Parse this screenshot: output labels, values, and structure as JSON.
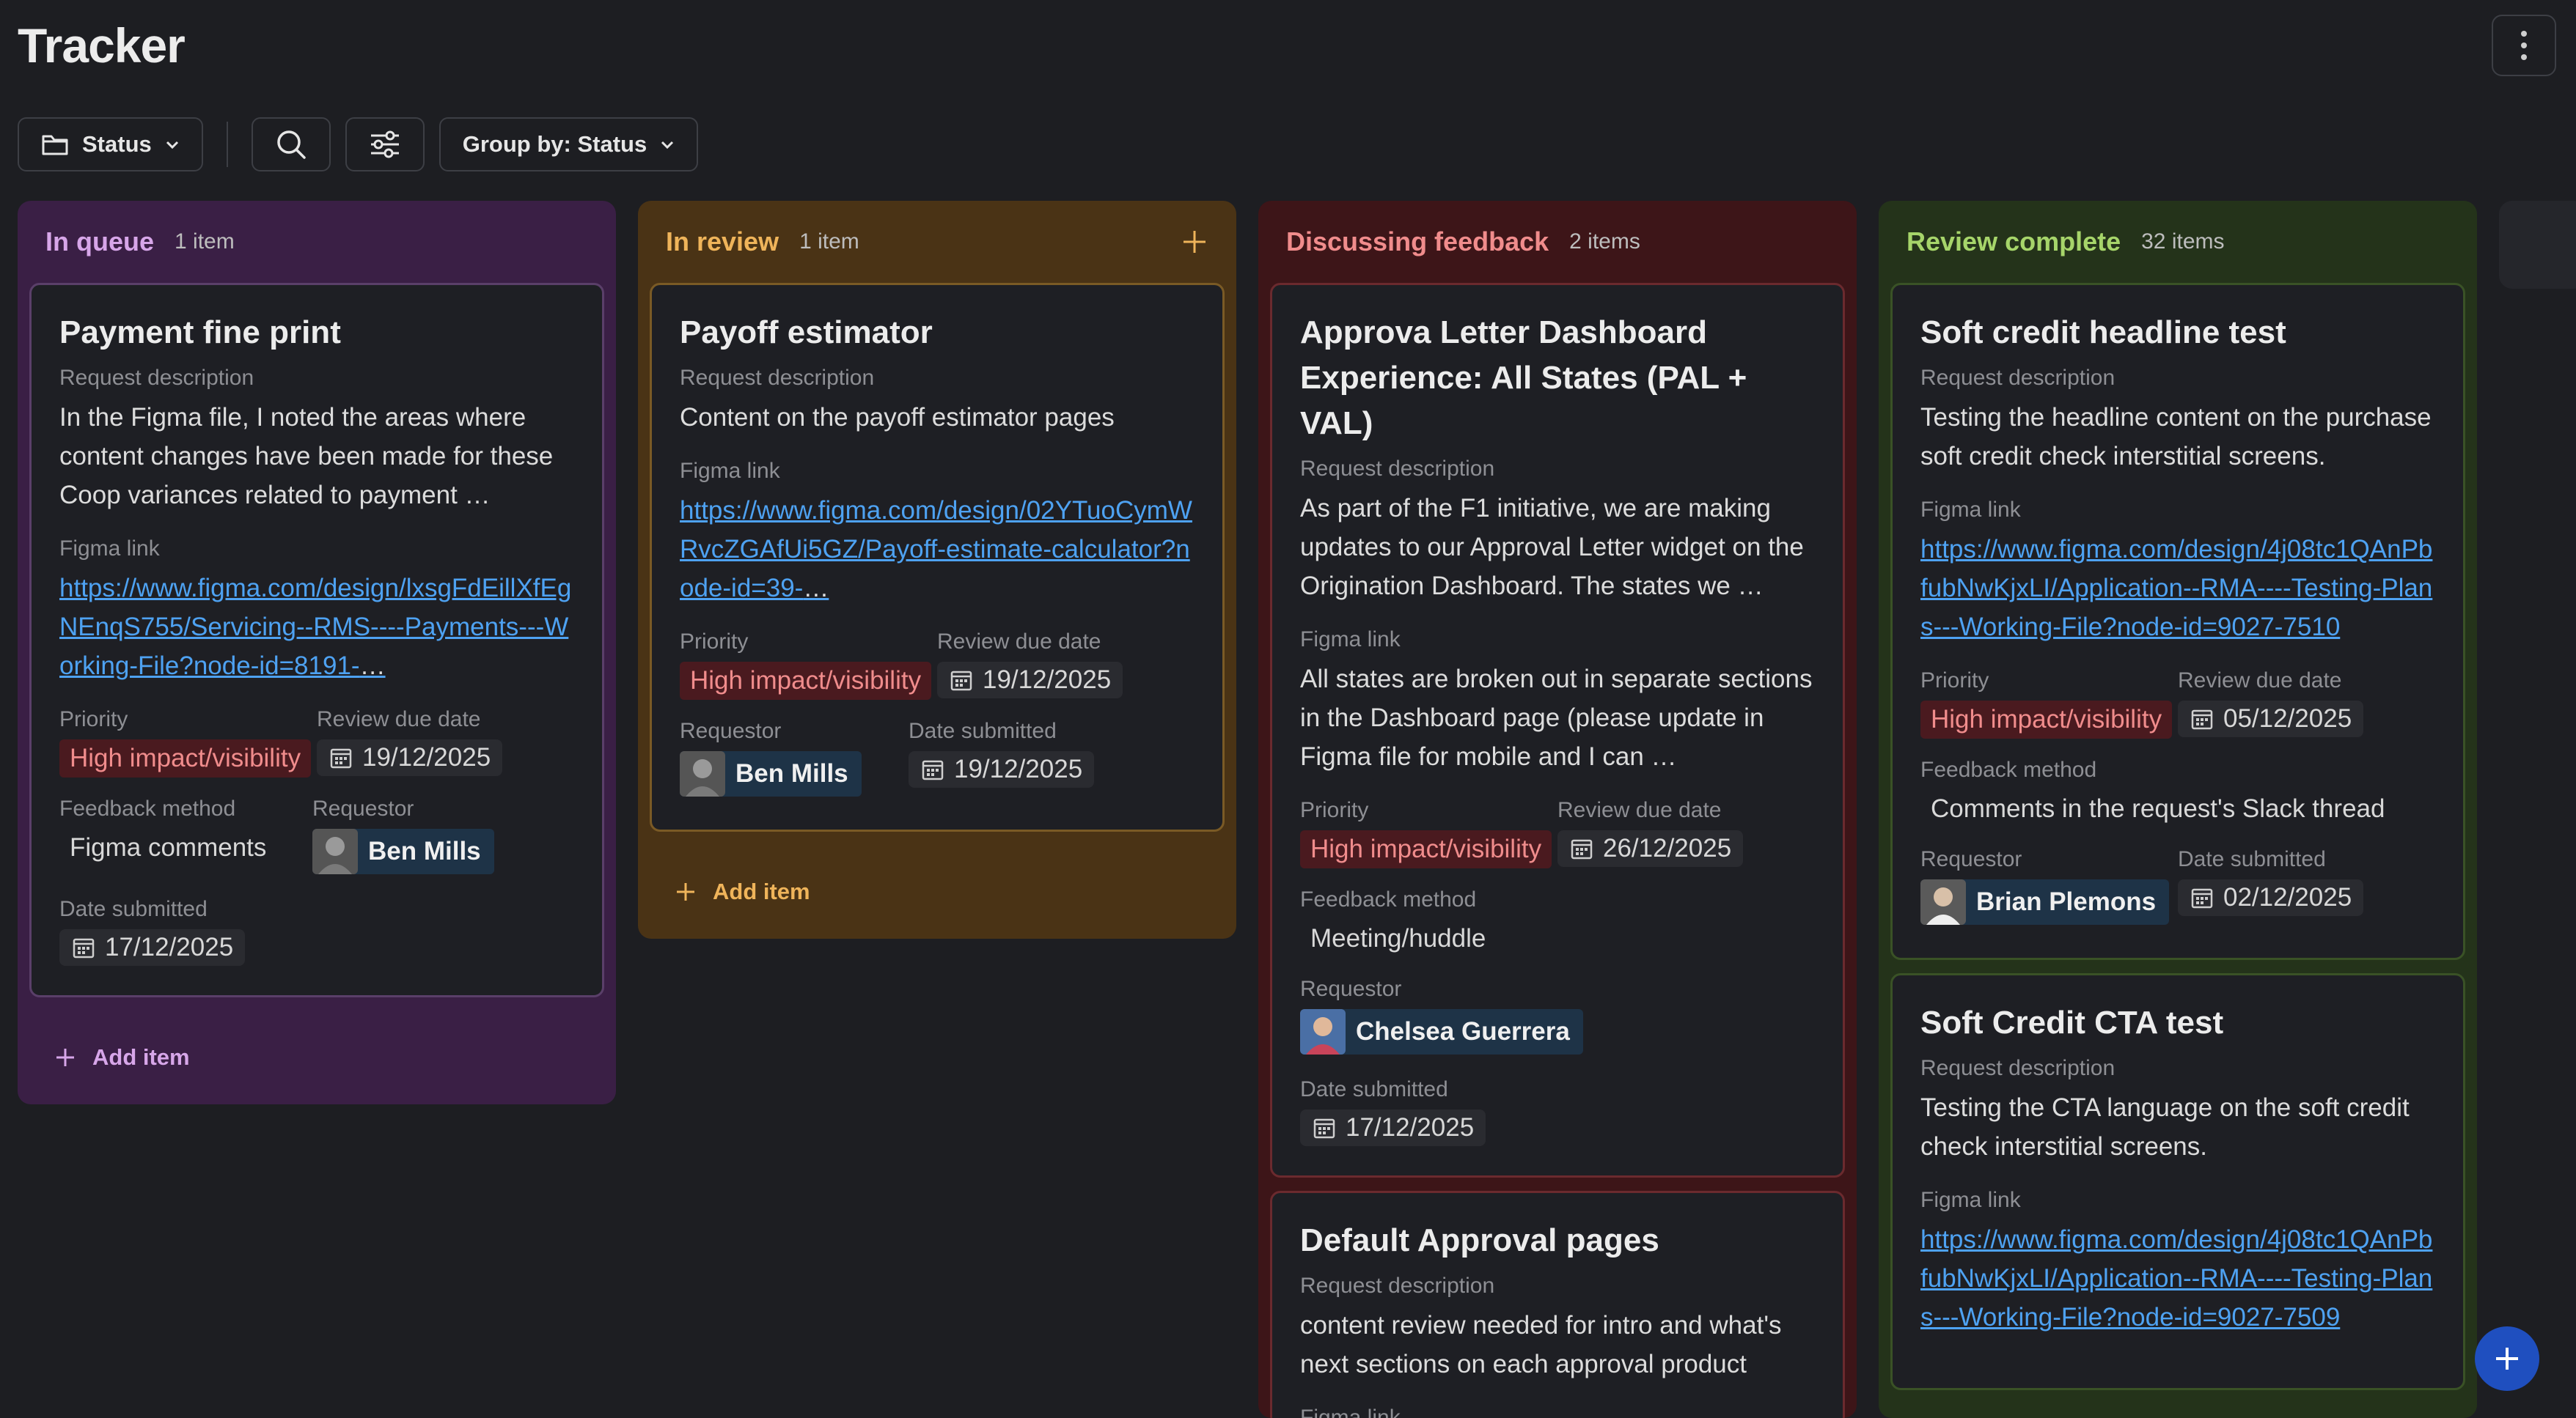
{
  "app": {
    "title": "Tracker"
  },
  "toolbar": {
    "status_label": "Status",
    "group_label": "Group by: Status"
  },
  "labels": {
    "request_description": "Request description",
    "figma_link": "Figma link",
    "priority": "Priority",
    "review_due_date": "Review due date",
    "feedback_method": "Feedback method",
    "requestor": "Requestor",
    "date_submitted": "Date submitted",
    "add_item": "Add item"
  },
  "columns": [
    {
      "name": "In queue",
      "count": "1 item",
      "cards": [
        {
          "title": "Payment fine print",
          "description": "In the Figma file, I noted the areas where content changes have been made for these Coop variances related to payment …",
          "figma_link": "https://www.figma.com/design/lxsgFdEillXfEgNEnqS755/Servicing--RMS----Payments---Working-File?node-id=8191-",
          "ellipsis": "…",
          "priority": "High impact/visibility",
          "review_due_date": "19/12/2025",
          "feedback_method": "Figma comments",
          "requestor": "Ben Mills",
          "date_submitted": "17/12/2025"
        }
      ]
    },
    {
      "name": "In review",
      "count": "1 item",
      "cards": [
        {
          "title": "Payoff estimator",
          "description": "Content on the payoff estimator pages",
          "figma_link": "https://www.figma.com/design/02YTuoCymWRvcZGAfUi5GZ/Payoff-estimate-calculator?node-id=39-",
          "ellipsis": "…",
          "priority": "High impact/visibility",
          "review_due_date": "19/12/2025",
          "requestor": "Ben Mills",
          "date_submitted": "19/12/2025"
        }
      ]
    },
    {
      "name": "Discussing feedback",
      "count": "2 items",
      "cards": [
        {
          "title": "Approva Letter Dashboard Experience: All States (PAL + VAL)",
          "description": "As part of the F1 initiative, we are making updates to our Approval Letter widget on the Origination Dashboard. The states we …",
          "figma_text": "All states are broken out in separate sections in the Dashboard page (please update in Figma file for mobile and I can …",
          "priority": "High impact/visibility",
          "review_due_date": "26/12/2025",
          "feedback_method": "Meeting/huddle",
          "requestor": "Chelsea Guerrera",
          "date_submitted": "17/12/2025"
        },
        {
          "title": "Default Approval pages",
          "description": "content review needed for intro and what's next sections on each approval product"
        }
      ]
    },
    {
      "name": "Review complete",
      "count": "32 items",
      "cards": [
        {
          "title": "Soft credit headline test",
          "description": "Testing the headline content on the purchase soft credit check interstitial screens.",
          "figma_link": "https://www.figma.com/design/4j08tc1QAnPbfubNwKjxLI/Application--RMA----Testing-Plans---Working-File?node-id=9027-7510",
          "priority": "High impact/visibility",
          "review_due_date": "05/12/2025",
          "feedback_method": "Comments in the request's Slack thread",
          "requestor": "Brian Plemons",
          "date_submitted": "02/12/2025"
        },
        {
          "title": "Soft Credit CTA test",
          "description": "Testing the CTA language on the soft credit check interstitial screens.",
          "figma_link": "https://www.figma.com/design/4j08tc1QAnPbfubNwKjxLI/Application--RMA----Testing-Plans---Working-File?node-id=9027-7509"
        }
      ]
    }
  ],
  "icons": {
    "more": "more-vertical-icon",
    "folder": "folder-icon",
    "search": "search-icon",
    "filter": "sliders-icon",
    "chevron": "chevron-down-icon",
    "calendar": "calendar-icon",
    "plus": "plus-icon"
  },
  "colors": {
    "background": "#1d1e22",
    "queue": "#3a1f45",
    "review": "#4a3315",
    "discussing": "#3d1518",
    "complete": "#24331a",
    "link": "#4ea2f2",
    "fab": "#1f4fbf"
  }
}
